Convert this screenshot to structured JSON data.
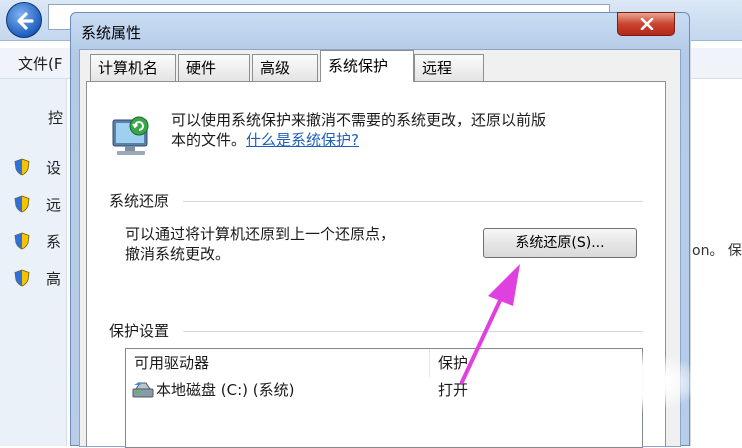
{
  "background": {
    "menu_file": "文件(F",
    "nav_items": [
      "控",
      "设",
      "远",
      "系",
      "高"
    ],
    "right_edge_text": "on。 保"
  },
  "dialog": {
    "title": "系统属性",
    "tabs": [
      "计算机名",
      "硬件",
      "高级",
      "系统保护",
      "远程"
    ],
    "active_tab": "系统保护",
    "description_line1": "可以使用系统保护来撤消不需要的系统更改，还原以前版",
    "description_line2_prefix": "本的文件。",
    "description_link": "什么是系统保护?",
    "restore_group": {
      "label": "系统还原",
      "text_line1": "可以通过将计算机还原到上一个还原点，",
      "text_line2": "撤消系统更改。",
      "button_label": "系统还原(S)..."
    },
    "protection_group": {
      "label": "保护设置",
      "columns": [
        "可用驱动器",
        "保护"
      ],
      "rows": [
        {
          "drive": "本地磁盘 (C:) (系统)",
          "protection": "打开"
        }
      ]
    }
  },
  "colors": {
    "accent_link": "#1e5fbd",
    "arrow": "#e040e0",
    "close": "#c9452f"
  },
  "icons": [
    "back-arrow-icon",
    "shield-icon",
    "system-restore-icon",
    "close-icon",
    "drive-icon"
  ]
}
